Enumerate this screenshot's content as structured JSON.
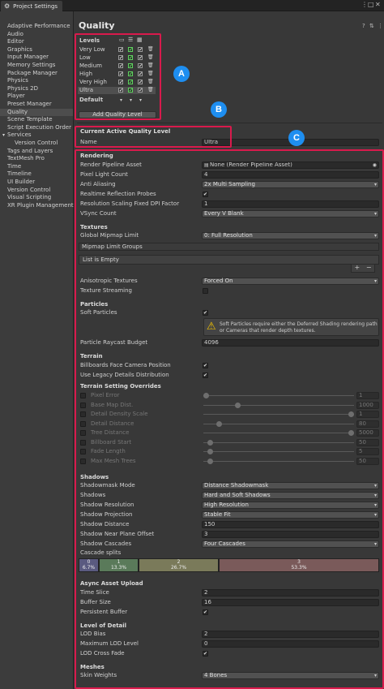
{
  "window": {
    "tab_title": "Project Settings",
    "tab_icon": "gear-icon",
    "menu_icon": "kebab-menu-icon",
    "maximize_icon": "maximize-icon",
    "close_icon": "close-icon"
  },
  "sidebar": {
    "selected": "Quality",
    "items": [
      "Adaptive Performance",
      "Audio",
      "Editor",
      "Graphics",
      "Input Manager",
      "Memory Settings",
      "Package Manager",
      "Physics",
      "Physics 2D",
      "Player",
      "Preset Manager",
      "Quality",
      "Scene Template",
      "Script Execution Order",
      "Services",
      "Version Control",
      "Tags and Layers",
      "TextMesh Pro",
      "Time",
      "Timeline",
      "UI Builder",
      "Version Control",
      "Visual Scripting",
      "XR Plugin Management"
    ]
  },
  "page": {
    "title": "Quality",
    "help_icon": "help-icon",
    "settings_icon": "settings-sliders-icon",
    "menu_icon": "kebab-menu-icon"
  },
  "annotations": {
    "a": "A",
    "b": "B",
    "c": "C",
    "color": "#d91a4c",
    "badge_color": "#1e8ef0"
  },
  "levels": {
    "header": "Levels",
    "platform_icons": [
      "monitor-icon",
      "server-icon",
      "windows-icon"
    ],
    "rows": [
      {
        "name": "Very Low",
        "checks": [
          "✔",
          "✔",
          "✔"
        ]
      },
      {
        "name": "Low",
        "checks": [
          "✔",
          "✔",
          "✔"
        ]
      },
      {
        "name": "Medium",
        "checks": [
          "✔",
          "✔",
          "✔"
        ]
      },
      {
        "name": "High",
        "checks": [
          "✔",
          "✔",
          "✔"
        ]
      },
      {
        "name": "Very High",
        "checks": [
          "✔",
          "✔",
          "✔"
        ]
      },
      {
        "name": "Ultra",
        "checks": [
          "✔",
          "✔",
          "✔"
        ]
      }
    ],
    "default_label": "Default",
    "add_button": "Add Quality Level"
  },
  "current_level": {
    "header": "Current Active Quality Level",
    "name_label": "Name",
    "name_value": "Ultra"
  },
  "rendering": {
    "header": "Rendering",
    "render_pipeline_label": "Render Pipeline Asset",
    "render_pipeline_value": "None (Render Pipeline Asset)",
    "pixel_light_label": "Pixel Light Count",
    "pixel_light_value": "4",
    "anti_aliasing_label": "Anti Aliasing",
    "anti_aliasing_value": "2x Multi Sampling",
    "realtime_refl_label": "Realtime Reflection Probes",
    "realtime_refl_checked": "✔",
    "res_scaling_label": "Resolution Scaling Fixed DPI Factor",
    "res_scaling_value": "1",
    "vsync_label": "VSync Count",
    "vsync_value": "Every V Blank"
  },
  "textures": {
    "header": "Textures",
    "global_mipmap_label": "Global Mipmap Limit",
    "global_mipmap_value": "0: Full Resolution",
    "mipmap_groups_label": "Mipmap Limit Groups",
    "list_empty": "List is Empty",
    "plus": "+",
    "minus": "−",
    "aniso_label": "Anisotropic Textures",
    "aniso_value": "Forced On",
    "streaming_label": "Texture Streaming"
  },
  "particles": {
    "header": "Particles",
    "soft_label": "Soft Particles",
    "soft_checked": "✔",
    "help_text": "Soft Particles require either the Deferred Shading rendering path or Cameras that render depth textures.",
    "raycast_label": "Particle Raycast Budget",
    "raycast_value": "4096"
  },
  "terrain": {
    "header": "Terrain",
    "billboards_label": "Billboards Face Camera Position",
    "billboards_checked": "✔",
    "legacy_label": "Use Legacy Details Distribution",
    "legacy_checked": "✔",
    "overrides_header": "Terrain Setting Overrides",
    "overrides": [
      {
        "label": "Pixel Error",
        "value": "1",
        "level": 0.0
      },
      {
        "label": "Base Map Dist.",
        "value": "1000",
        "level": 0.22
      },
      {
        "label": "Detail Density Scale",
        "value": "1",
        "level": 1.0
      },
      {
        "label": "Detail Distance",
        "value": "80",
        "level": 0.09
      },
      {
        "label": "Tree Distance",
        "value": "5000",
        "level": 1.0
      },
      {
        "label": "Billboard Start",
        "value": "50",
        "level": 0.03
      },
      {
        "label": "Fade Length",
        "value": "5",
        "level": 0.03
      },
      {
        "label": "Max Mesh Trees",
        "value": "50",
        "level": 0.03
      }
    ]
  },
  "shadows": {
    "header": "Shadows",
    "rows": [
      {
        "label": "Shadowmask Mode",
        "value": "Distance Shadowmask",
        "kind": "dd"
      },
      {
        "label": "Shadows",
        "value": "Hard and Soft Shadows",
        "kind": "dd"
      },
      {
        "label": "Shadow Resolution",
        "value": "High Resolution",
        "kind": "dd"
      },
      {
        "label": "Shadow Projection",
        "value": "Stable Fit",
        "kind": "dd"
      },
      {
        "label": "Shadow Distance",
        "value": "150",
        "kind": "fld"
      },
      {
        "label": "Shadow Near Plane Offset",
        "value": "3",
        "kind": "fld"
      },
      {
        "label": "Shadow Cascades",
        "value": "Four Cascades",
        "kind": "dd"
      }
    ],
    "cascade_label": "Cascade splits",
    "cascades": [
      {
        "index": "0",
        "pct": "6.7%",
        "color": "#5a5a80"
      },
      {
        "index": "1",
        "pct": "13.3%",
        "color": "#5a7a5a"
      },
      {
        "index": "2",
        "pct": "26.7%",
        "color": "#7a7a5a"
      },
      {
        "index": "3",
        "pct": "53.3%",
        "color": "#7a5a5a"
      }
    ]
  },
  "async": {
    "header": "Async Asset Upload",
    "time_slice_label": "Time Slice",
    "time_slice_value": "2",
    "buffer_label": "Buffer Size",
    "buffer_value": "16",
    "persistent_label": "Persistent Buffer",
    "persistent_checked": "✔"
  },
  "lod": {
    "header": "Level of Detail",
    "bias_label": "LOD Bias",
    "bias_value": "2",
    "max_label": "Maximum LOD Level",
    "max_value": "0",
    "crossfade_label": "LOD Cross Fade",
    "crossfade_checked": "✔"
  },
  "meshes": {
    "header": "Meshes",
    "skin_label": "Skin Weights",
    "skin_value": "4 Bones"
  }
}
